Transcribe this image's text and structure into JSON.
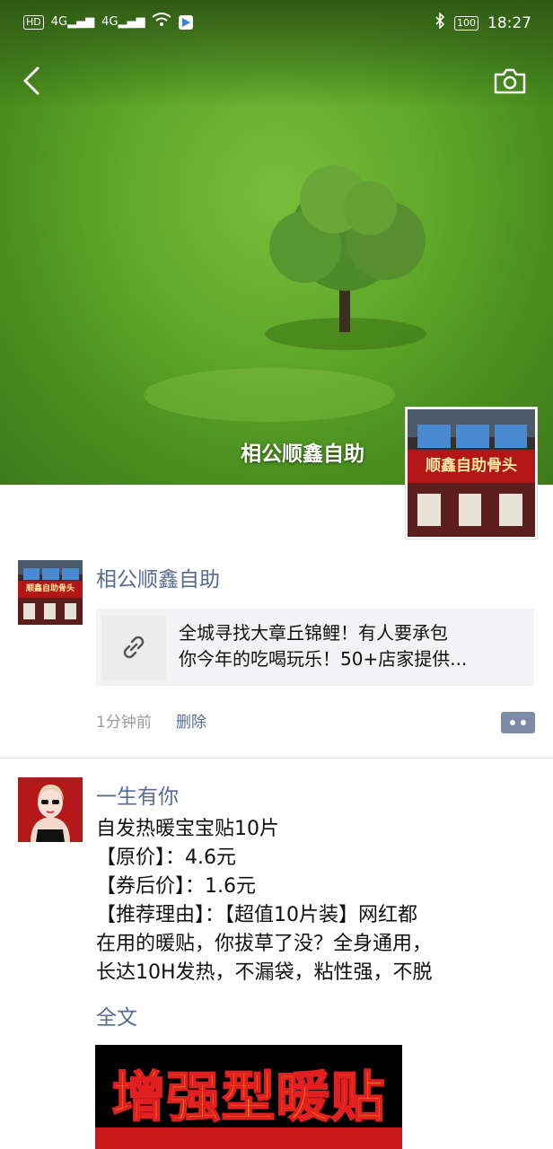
{
  "status_bar": {
    "hd": "HD",
    "net1": "4G",
    "net2": "4G",
    "battery": "100",
    "time": "18:27"
  },
  "cover": {
    "owner_name": "相公顺鑫自助"
  },
  "icons": [
    "back-arrow-icon",
    "camera-icon",
    "link-icon",
    "more-dots-icon",
    "bluetooth-icon",
    "wifi-icon",
    "signal-icon",
    "battery-icon"
  ],
  "shop_sign": "顺鑫自助骨头",
  "post1": {
    "author": "相公顺鑫自助",
    "link_lines": [
      "全城寻找大章丘锦鲤！有人要承包",
      "你今年的吃喝玩乐！50+店家提供..."
    ],
    "time": "1分钟前",
    "delete_label": "删除"
  },
  "post2": {
    "author": "一生有你",
    "lines": [
      "自发热暖宝宝贴10片",
      "【原价】：4.6元",
      "【券后价】：1.6元",
      "【推荐理由】：【超值10片装】网红都",
      "在用的暖贴，你拔草了没？全身通用，",
      "长达10H发热，不漏袋，粘性强，不脱"
    ],
    "fulltext_label": "全文",
    "image_title": "增强型暖贴"
  },
  "colors": {
    "link_blue": "#576b95",
    "grass": "#5fa82a"
  }
}
